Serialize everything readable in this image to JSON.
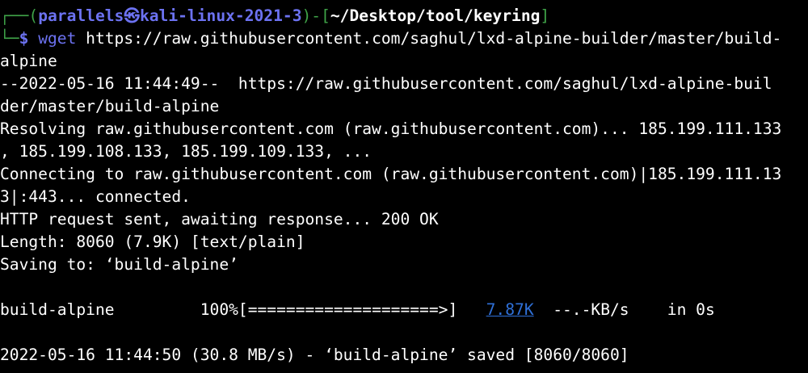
{
  "prompt": {
    "corner_top": "┌──(",
    "user_host": "parallels㉿kali-linux-2021-3",
    "mid": ")-[",
    "path": "~/Desktop/tool/keyring",
    "end": "]",
    "corner_bottom": "└─",
    "symbol": "$",
    "command": "wget",
    "args_line1": " https://raw.githubusercontent.com/saghul/lxd-alpine-builder/master/build-",
    "args_line2": "alpine"
  },
  "output": [
    "--2022-05-16 11:44:49--  https://raw.githubusercontent.com/saghul/lxd-alpine-buil",
    "der/master/build-alpine",
    "Resolving raw.githubusercontent.com (raw.githubusercontent.com)... 185.199.111.133",
    ", 185.199.108.133, 185.199.109.133, ...",
    "Connecting to raw.githubusercontent.com (raw.githubusercontent.com)|185.199.111.13",
    "3|:443... connected.",
    "HTTP request sent, awaiting response... 200 OK",
    "Length: 8060 (7.9K) [text/plain]",
    "Saving to: ‘build-alpine’"
  ],
  "progress": {
    "filename": "build-alpine",
    "percent_text": "100%",
    "bar": "[====================>]",
    "size": "7.87K",
    "rate": "--.-KB/s",
    "time": "in 0s",
    "fraction": 1.0
  },
  "final": "2022-05-16 11:44:50 (30.8 MB/s) - ‘build-alpine’ saved [8060/8060]",
  "colors": {
    "background": "#000000",
    "text": "#ffffff",
    "prompt_green": "#3fa348",
    "prompt_blue": "#6c72f1",
    "link_blue": "#2f70d8"
  }
}
